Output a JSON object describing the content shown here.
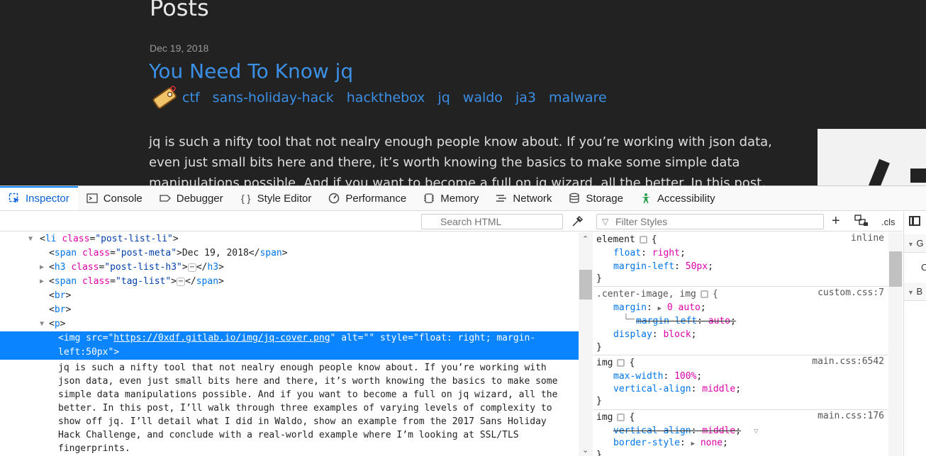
{
  "page": {
    "heading": "Posts",
    "post": {
      "date": "Dec 19, 2018",
      "title": "You Need To Know jq",
      "tags": [
        "ctf",
        "sans-holiday-hack",
        "hackthebox",
        "jq",
        "waldo",
        "ja3",
        "malware"
      ],
      "intro": "jq is such a nifty tool that not nealry enough people know about. If you’re working with json data, even just small bits here and there, it’s worth knowing the basics to make some simple data manipulations possible. And if you want to become a full on jq wizard, all the better. In this post, I’ll"
    },
    "colors": {
      "page_bg": "#222222",
      "link": "#3b8fe5",
      "accent": "#0a84ff"
    }
  },
  "devtools": {
    "tabs": [
      {
        "label": "Inspector",
        "icon": "inspector-icon",
        "selected": true
      },
      {
        "label": "Console",
        "icon": "console-icon"
      },
      {
        "label": "Debugger",
        "icon": "debugger-icon"
      },
      {
        "label": "Style Editor",
        "icon": "style-editor-icon"
      },
      {
        "label": "Performance",
        "icon": "performance-icon"
      },
      {
        "label": "Memory",
        "icon": "memory-icon"
      },
      {
        "label": "Network",
        "icon": "network-icon"
      },
      {
        "label": "Storage",
        "icon": "storage-icon"
      },
      {
        "label": "Accessibility",
        "icon": "accessibility-icon"
      }
    ],
    "markup": {
      "search_placeholder": "Search HTML",
      "nodes": {
        "li_tag": "li",
        "li_class_attr": "class",
        "li_class_val": "\"post-list-li\"",
        "span_tag": "span",
        "span_class_attr": "class",
        "span_class_val": "\"post-meta\"",
        "span_text": "Dec 19, 2018",
        "h3_tag": "h3",
        "h3_class_attr": "class",
        "h3_class_val": "\"post-list-h3\"",
        "taglist_tag": "span",
        "taglist_class_attr": "class",
        "taglist_class_val": "\"tag-list\"",
        "br1": "br",
        "br2": "br",
        "p_tag": "p",
        "img_tag": "img",
        "img_src_attr": "src",
        "img_src_val": "https://0xdf.gitlab.io/img/jq-cover.png",
        "img_alt_attr": "alt",
        "img_alt_val": "\"\"",
        "img_style_attr": "style",
        "img_style_val_1": "\"float: right; margin-",
        "img_style_val_2": "left:50px\"",
        "ellipsis": "⋯"
      },
      "paragraph": "jq is such a nifty tool that not nealry enough people know about. If you’re working with\njson data, even just small bits here and there, it’s worth knowing the basics to make some\nsimple data manipulations possible. And if you want to become a full on jq wizard, all the\nbetter. In this post, I’ll walk through three examples of varying levels of complexity to\nshow off jq. I’ll detail what I did in Waldo, show an example from the 2017 Sans Holiday\nHack Challenge, and conclude with a real-world example where I’m looking at SSL/TLS\nfingerprints."
    },
    "rules": {
      "filter_placeholder": "Filter Styles",
      "cls_label": ".cls",
      "element": {
        "selector": "element",
        "source": "inline",
        "p1": "float",
        "v1": "right",
        "p2": "margin-left",
        "v2": "50px"
      },
      "center": {
        "selector": ".center-image, img",
        "source": "custom.css:7",
        "p1": "margin",
        "v1": "0 auto",
        "p1sub": "margin-left",
        "v1sub": "auto",
        "p2": "display",
        "v2": "block"
      },
      "img1": {
        "selector": "img",
        "source": "main.css:6542",
        "p1": "max-width",
        "v1": "100%",
        "p2": "vertical-align",
        "v2": "middle"
      },
      "img2": {
        "selector": "img",
        "source": "main.css:176",
        "p1": "vertical-align",
        "v1": "middle",
        "p2": "border-style",
        "v2": "none"
      }
    },
    "sidebar": {
      "row1": "G",
      "row1b": "C",
      "row2": "B"
    }
  }
}
